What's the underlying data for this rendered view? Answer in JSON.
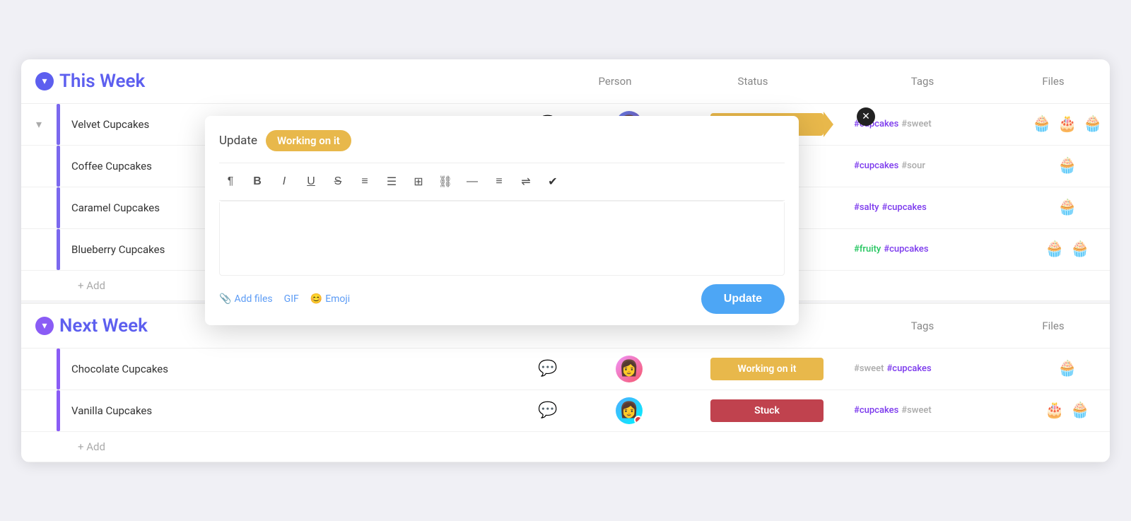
{
  "thisWeek": {
    "title": "This Week",
    "columns": {
      "person": "Person",
      "status": "Status",
      "tags": "Tags",
      "files": "Files"
    },
    "tasks": [
      {
        "id": "velvet",
        "name": "Velvet Cupcakes",
        "colorBar": "#7b68ee",
        "hasComment": true,
        "commentCount": "1",
        "hasAvatar": true,
        "avatarClass": "avatar-1",
        "status": "Working on it",
        "statusClass": "status-working",
        "tags": [
          {
            "text": "#cupcakes",
            "class": "tag-purple"
          },
          {
            "text": "#sweet",
            "class": "tag-gray"
          }
        ],
        "files": [
          "🧁",
          "🎂",
          "🧁"
        ]
      },
      {
        "id": "coffee",
        "name": "Coffee Cupcakes",
        "colorBar": "#7b68ee",
        "hasComment": false,
        "hasAvatar": false,
        "status": "",
        "tags": [
          {
            "text": "#cupcakes",
            "class": "tag-purple"
          },
          {
            "text": "#sour",
            "class": "tag-gray"
          }
        ],
        "files": [
          "🧁"
        ]
      },
      {
        "id": "caramel",
        "name": "Caramel Cupcakes",
        "colorBar": "#7b68ee",
        "hasComment": false,
        "hasAvatar": false,
        "status": "",
        "tags": [
          {
            "text": "#salty",
            "class": "tag-purple"
          },
          {
            "text": "#cupcakes",
            "class": "tag-purple"
          }
        ],
        "files": [
          "🧁"
        ]
      },
      {
        "id": "blueberry",
        "name": "Blueberry Cupcakes",
        "colorBar": "#7b68ee",
        "hasComment": false,
        "hasAvatar": false,
        "status": "",
        "tags": [
          {
            "text": "#fruity",
            "class": "tag-green"
          },
          {
            "text": "#cupcakes",
            "class": "tag-purple"
          }
        ],
        "files": [
          "🧁",
          "🧁"
        ]
      }
    ],
    "addLabel": "+ Add"
  },
  "nextWeek": {
    "title": "Next Week",
    "columns": {
      "tags": "Tags",
      "files": "Files"
    },
    "tasks": [
      {
        "id": "chocolate",
        "name": "Chocolate Cupcakes",
        "colorBar": "#7b68ee",
        "hasComment": true,
        "commentCount": "",
        "hasAvatar": true,
        "avatarClass": "avatar-2",
        "status": "Working on it",
        "statusClass": "status-working",
        "tags": [
          {
            "text": "#sweet",
            "class": "tag-gray"
          },
          {
            "text": "#cupcakes",
            "class": "tag-purple"
          }
        ],
        "files": [
          "🧁"
        ]
      },
      {
        "id": "vanilla",
        "name": "Vanilla Cupcakes",
        "colorBar": "#7b68ee",
        "hasComment": true,
        "commentCount": "",
        "hasAvatar": true,
        "avatarClass": "avatar-3",
        "status": "Stuck",
        "statusClass": "status-stuck",
        "tags": [
          {
            "text": "#cupcakes",
            "class": "tag-purple"
          },
          {
            "text": "#sweet",
            "class": "tag-gray"
          }
        ],
        "files": [
          "🎂",
          "🧁"
        ]
      }
    ],
    "addLabel": "+ Add"
  },
  "popup": {
    "headerLabel": "Update",
    "statusLabel": "Working on it",
    "toolbar": [
      {
        "icon": "¶",
        "name": "paragraph"
      },
      {
        "icon": "B",
        "name": "bold",
        "bold": true
      },
      {
        "icon": "I",
        "name": "italic",
        "italic": true
      },
      {
        "icon": "U",
        "name": "underline"
      },
      {
        "icon": "S",
        "name": "strikethrough"
      },
      {
        "icon": "≡",
        "name": "ordered-list"
      },
      {
        "icon": "☰",
        "name": "unordered-list"
      },
      {
        "icon": "▦",
        "name": "table"
      },
      {
        "icon": "⛓",
        "name": "link"
      },
      {
        "icon": "—",
        "name": "horizontal-rule"
      },
      {
        "icon": "≡",
        "name": "align"
      },
      {
        "icon": "⇌",
        "name": "indent"
      },
      {
        "icon": "✔",
        "name": "check"
      }
    ],
    "addFilesLabel": "Add files",
    "gifLabel": "GIF",
    "emojiLabel": "Emoji",
    "updateButtonLabel": "Update"
  }
}
